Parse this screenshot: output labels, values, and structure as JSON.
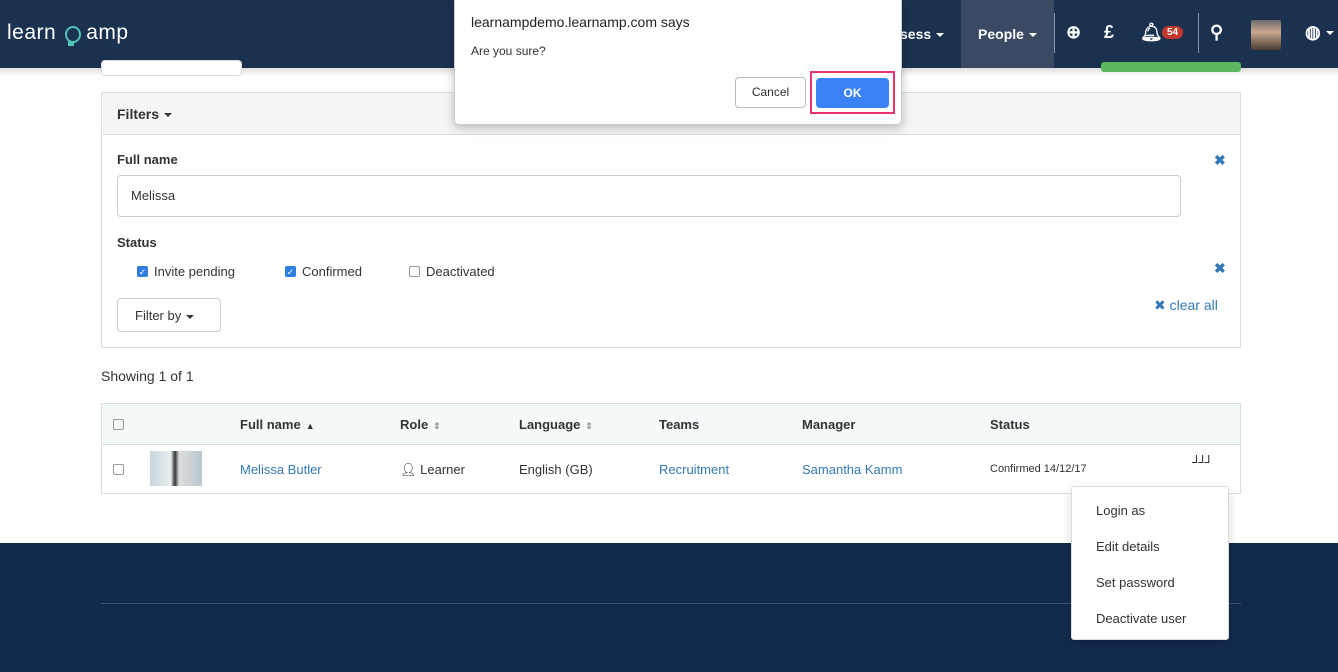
{
  "nav": {
    "logo_left": "learn",
    "logo_right": "amp",
    "items": [
      {
        "label": "sess"
      },
      {
        "label": "People"
      }
    ],
    "notifications": "54",
    "icons": [
      "plus-circle-icon",
      "pound-icon",
      "bell-icon",
      "search-icon",
      "avatar",
      "globe-icon"
    ]
  },
  "filters": {
    "title": "Filters",
    "full_name_label": "Full name",
    "full_name_value": "Melissa",
    "status_label": "Status",
    "statuses": [
      {
        "label": "Invite pending",
        "checked": true
      },
      {
        "label": "Confirmed",
        "checked": true
      },
      {
        "label": "Deactivated",
        "checked": false
      }
    ],
    "filter_by": "Filter by",
    "clear_all": "clear all"
  },
  "showing": "Showing 1 of 1",
  "table": {
    "headers": [
      "Full name",
      "Role",
      "Language",
      "Teams",
      "Manager",
      "Status"
    ],
    "row": {
      "name": "Melissa Butler",
      "role": "Learner",
      "language": "English (GB)",
      "team": "Recruitment",
      "manager": "Samantha Kamm",
      "status": "Confirmed 14/12/17",
      "actions": "⅃⅃⅃"
    }
  },
  "menu": [
    "Login as",
    "Edit details",
    "Set password",
    "Deactivate user"
  ],
  "dialog": {
    "title": "learnampdemo.learnamp.com says",
    "message": "Are you sure?",
    "cancel": "Cancel",
    "ok": "OK"
  }
}
